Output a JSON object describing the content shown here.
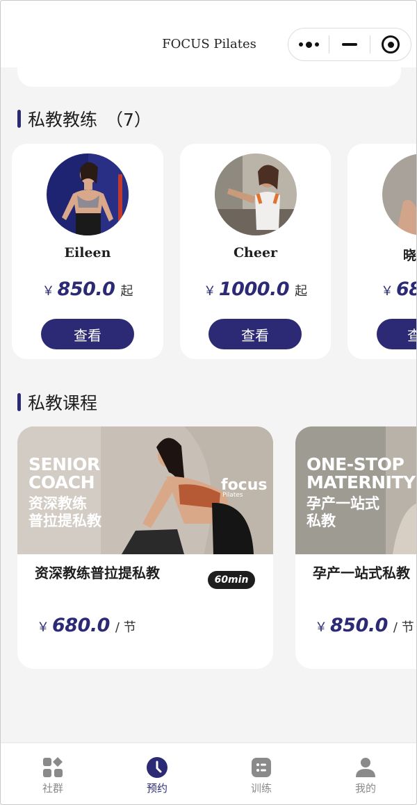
{
  "header": {
    "title": "FOCUS Pilates"
  },
  "coaches_section": {
    "title": "私教教练",
    "count": "（7）"
  },
  "coaches": [
    {
      "name": "Eileen",
      "currency": "￥",
      "price": "850.0",
      "unit": "起",
      "button": "查看"
    },
    {
      "name": "Cheer",
      "currency": "￥",
      "price": "1000.0",
      "unit": "起",
      "button": "查看"
    },
    {
      "name": "晓",
      "currency": "￥",
      "price": "68",
      "unit": "",
      "button": "查"
    }
  ],
  "courses_section": {
    "title": "私教课程"
  },
  "courses": [
    {
      "banner_en": [
        "SENIOR",
        "COACH"
      ],
      "banner_cn": [
        "资深教练",
        "普拉提私教"
      ],
      "brand": "focus",
      "brand_sub": "Pilates",
      "name": "资深教练普拉提私教",
      "badge": "60min",
      "currency": "￥",
      "price": "680.0",
      "unit": "/ 节"
    },
    {
      "banner_en": [
        "ONE-STOP",
        "MATERNITY"
      ],
      "banner_cn": [
        "孕产一站式",
        "私教"
      ],
      "name": "孕产一站式私教",
      "currency": "￥",
      "price": "850.0",
      "unit": "/ 节"
    }
  ],
  "tabbar": {
    "items": [
      {
        "label": "社群",
        "icon": "community-icon",
        "active": false
      },
      {
        "label": "预约",
        "icon": "clock-icon",
        "active": true
      },
      {
        "label": "训练",
        "icon": "training-icon",
        "active": false
      },
      {
        "label": "我的",
        "icon": "profile-icon",
        "active": false
      }
    ]
  },
  "colors": {
    "accent": "#2c2a74",
    "background": "#f4f4f4",
    "inactive": "#8a8a8a"
  }
}
